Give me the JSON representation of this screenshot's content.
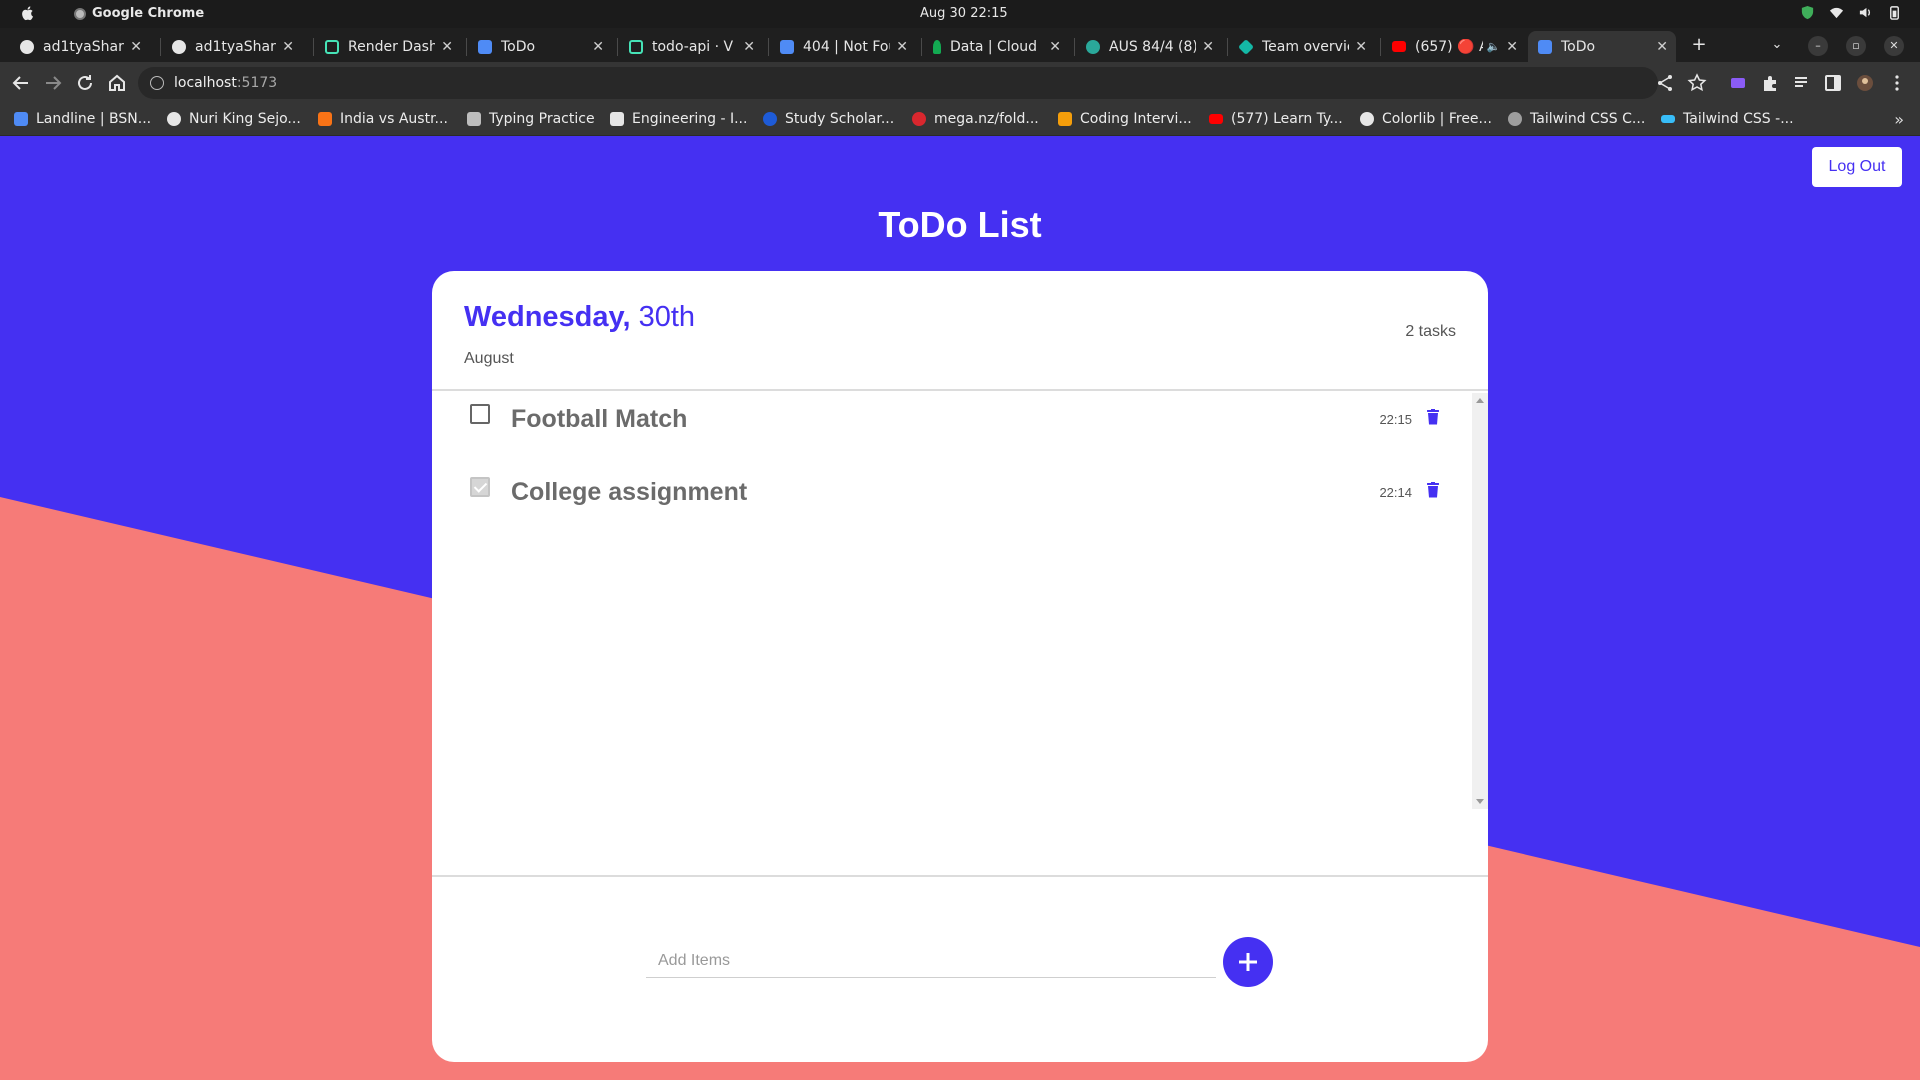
{
  "os": {
    "app_name": "Google Chrome",
    "clock": "Aug 30  22:15"
  },
  "browser": {
    "tabs": [
      {
        "title": "ad1tyaSharm",
        "icon": "github-icon",
        "color": "#e6e6e6"
      },
      {
        "title": "ad1tyaSharm",
        "icon": "github-icon",
        "color": "#e6e6e6"
      },
      {
        "title": "Render Dash",
        "icon": "render-icon",
        "color": "#46e3b7"
      },
      {
        "title": "ToDo",
        "icon": "vite-icon",
        "color": "#4f8bf5"
      },
      {
        "title": "todo-api · V",
        "icon": "render-icon",
        "color": "#46e3b7"
      },
      {
        "title": "404 | Not Fou",
        "icon": "vite-icon",
        "color": "#4f8bf5"
      },
      {
        "title": "Data | Cloud",
        "icon": "mongodb-icon",
        "color": "#13aa52"
      },
      {
        "title": "AUS 84/4 (8)",
        "icon": "cricket-icon",
        "color": "#2aa89a"
      },
      {
        "title": "Team overvie",
        "icon": "diamond-icon",
        "color": "#14b8a6"
      },
      {
        "title": "(657) 🔴 A",
        "icon": "youtube-icon",
        "color": "#ff0000"
      },
      {
        "title": "ToDo",
        "icon": "vite-icon",
        "color": "#4f8bf5",
        "active": true
      }
    ],
    "url_host": "localhost",
    "url_port": ":5173",
    "bookmarks": [
      {
        "label": "Landline | BSN...",
        "color": "#4f8bf5"
      },
      {
        "label": "Nuri King Sejo...",
        "color": "#e6e6e6"
      },
      {
        "label": "India vs Austr...",
        "color": "#f97316"
      },
      {
        "label": "Typing Practice",
        "color": "#bdbdbd"
      },
      {
        "label": "Engineering - I...",
        "color": "#e6e6e6"
      },
      {
        "label": "Study Scholar...",
        "color": "#1e5bd7"
      },
      {
        "label": "mega.nz/fold...",
        "color": "#d9272e"
      },
      {
        "label": "Coding Intervi...",
        "color": "#f59e0b"
      },
      {
        "label": "(577) Learn Ty...",
        "color": "#ff0000"
      },
      {
        "label": "Colorlib | Free...",
        "color": "#e6e6e6"
      },
      {
        "label": "Tailwind CSS C...",
        "color": "#9e9e9e"
      },
      {
        "label": "Tailwind CSS -...",
        "color": "#38bdf8"
      }
    ]
  },
  "app": {
    "logout_label": "Log Out",
    "title": "ToDo List",
    "date": {
      "weekday": "Wednesday,",
      "day": "30th",
      "month": "August"
    },
    "task_count": "2 tasks",
    "tasks": [
      {
        "text": "Football Match",
        "time": "22:15",
        "done": false
      },
      {
        "text": "College assignment",
        "time": "22:14",
        "done": true
      }
    ],
    "add_placeholder": "Add Items",
    "colors": {
      "primary": "#4530f2",
      "coral": "#f67b78",
      "card": "#ffffff"
    }
  }
}
